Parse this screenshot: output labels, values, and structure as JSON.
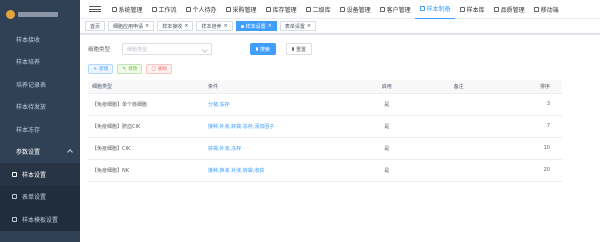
{
  "sidebar": {
    "items": [
      {
        "label": "样本接收"
      },
      {
        "label": "样本培养"
      },
      {
        "label": "培养记录表"
      },
      {
        "label": "样本待发放"
      },
      {
        "label": "样本冻存"
      }
    ],
    "group": {
      "label": "参数设置"
    },
    "subitems": [
      {
        "label": "样本设置"
      },
      {
        "label": "表单设置"
      },
      {
        "label": "样本模板设置"
      }
    ]
  },
  "topnav": {
    "items": [
      {
        "label": "系统管理"
      },
      {
        "label": "工作流"
      },
      {
        "label": "个人待办"
      },
      {
        "label": "采购管理"
      },
      {
        "label": "库存管理"
      },
      {
        "label": "二级库"
      },
      {
        "label": "设备管理"
      },
      {
        "label": "客户管理"
      },
      {
        "label": "样本制备"
      },
      {
        "label": "样本库"
      },
      {
        "label": "品质管理"
      },
      {
        "label": "移动端"
      }
    ]
  },
  "tags": [
    {
      "label": "首页"
    },
    {
      "label": "细胞应用申请"
    },
    {
      "label": "样本接收"
    },
    {
      "label": "样本培养"
    },
    {
      "label": "样本设置"
    },
    {
      "label": "表单设置"
    }
  ],
  "search": {
    "label": "细胞类型",
    "placeholder": "细胞类型",
    "search_btn": "搜索",
    "reset_btn": "重置"
  },
  "toolbar": {
    "add": "新增",
    "edit": "修改",
    "delete": "删除"
  },
  "table": {
    "headers": {
      "name": "细胞类型",
      "cond": "条件",
      "enable": "启用",
      "note": "备注",
      "sort": "排序"
    },
    "rows": [
      {
        "name": "【免疫细胞】单个核细胞",
        "cond": "分装,冻存",
        "enable": "是",
        "note": "",
        "sort": "3"
      },
      {
        "name": "【免疫细胞】脐血CIK",
        "cond": "接种,补液,转袋,冻存,添加因子",
        "enable": "是",
        "note": "",
        "sort": "7"
      },
      {
        "name": "【免疫细胞】CIK",
        "cond": "转袋,补液,冻存",
        "enable": "是",
        "note": "",
        "sort": "10"
      },
      {
        "name": "【免疫细胞】NK",
        "cond": "接种,换液,补液,转袋,收获",
        "enable": "是",
        "note": "",
        "sort": "20"
      }
    ]
  },
  "colors": {
    "sidebar_bg": "#304156",
    "primary": "#409eff",
    "success": "#67c23a",
    "danger": "#f56c6c"
  }
}
